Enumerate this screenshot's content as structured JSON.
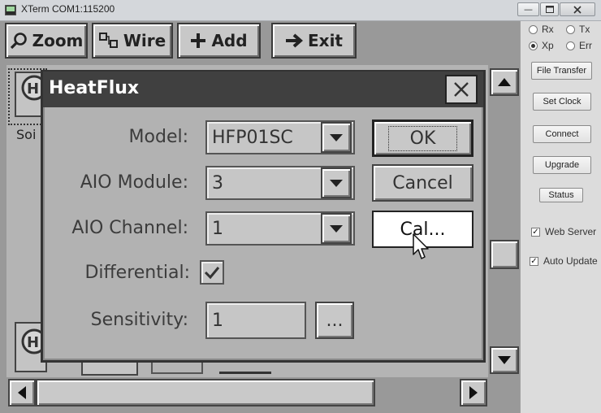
{
  "window": {
    "title": "XTerm COM1:115200"
  },
  "toolbar": {
    "zoom": "Zoom",
    "wire": "Wire",
    "add": "Add",
    "exit": "Exit"
  },
  "canvas": {
    "node_label": "Soi"
  },
  "dialog": {
    "title": "HeatFlux",
    "model_label": "Model:",
    "model_value": "HFP01SC",
    "aio_module_label": "AIO Module:",
    "aio_module_value": "3",
    "aio_channel_label": "AIO Channel:",
    "aio_channel_value": "1",
    "differential_label": "Differential:",
    "differential_checked": true,
    "sensitivity_label": "Sensitivity:",
    "sensitivity_value": "1",
    "ellipsis_label": "...",
    "ok_label": "OK",
    "cancel_label": "Cancel",
    "cal_label": "Cal..."
  },
  "panel": {
    "radio_rx": "Rx",
    "radio_tx": "Tx",
    "radio_xp": "Xp",
    "radio_err": "Err",
    "selected_radio": "Xp",
    "file_transfer": "File Transfer",
    "set_clock": "Set Clock",
    "connect": "Connect",
    "upgrade": "Upgrade",
    "status": "Status",
    "web_server": "Web Server",
    "web_server_checked": true,
    "auto_update": "Auto Update",
    "auto_update_checked": true
  },
  "colors": {
    "dialog_title_bg": "#404040",
    "screen_bg": "#999999"
  }
}
